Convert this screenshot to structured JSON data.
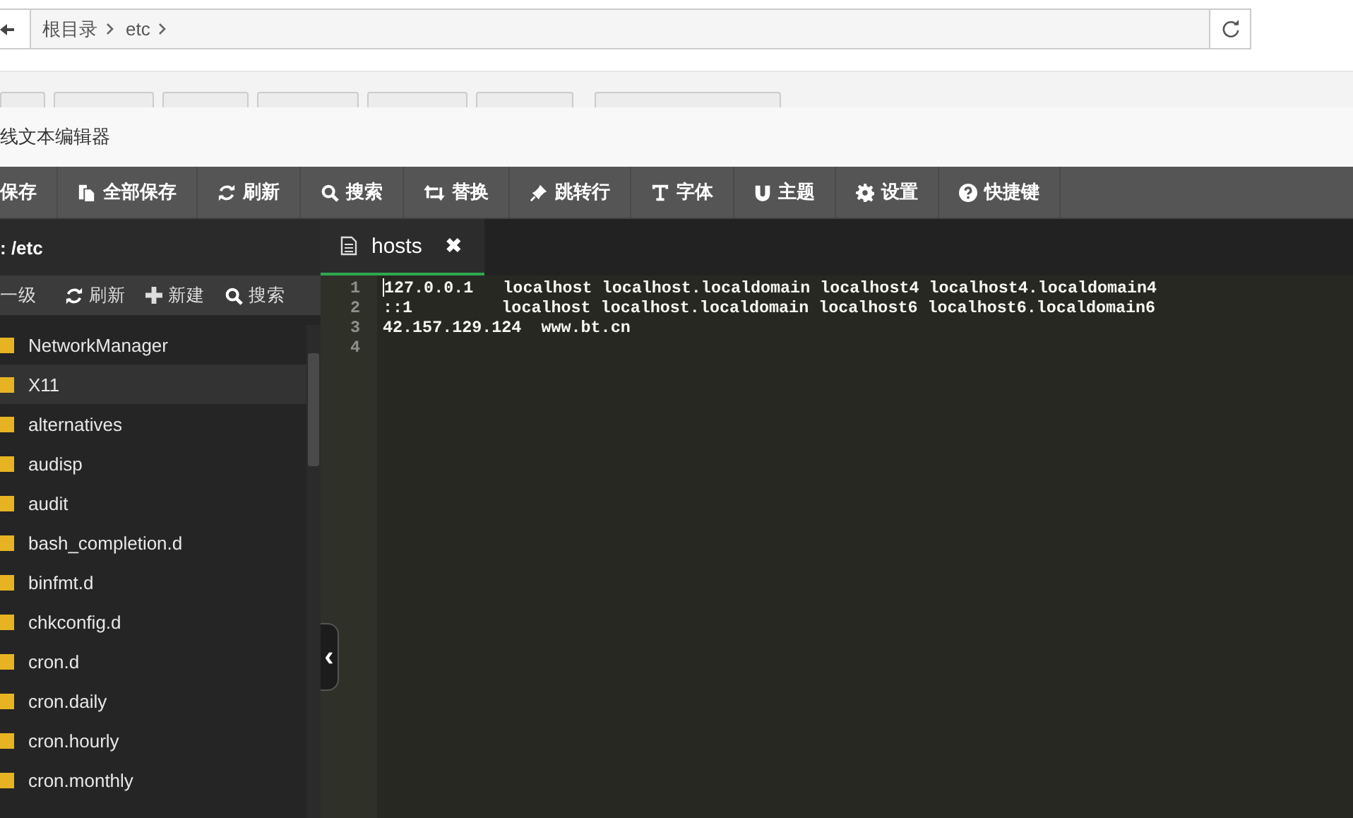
{
  "breadcrumb": {
    "items": [
      "根目录",
      "etc"
    ]
  },
  "editor_title": "线文本编辑器",
  "toolbar": [
    {
      "label": "保存"
    },
    {
      "label": "全部保存",
      "kind": "copy"
    },
    {
      "label": "刷新",
      "kind": "refresh"
    },
    {
      "label": "搜索",
      "kind": "search"
    },
    {
      "label": "替换",
      "kind": "swap"
    },
    {
      "label": "跳转行",
      "kind": "pin"
    },
    {
      "label": "字体",
      "kind": "font"
    },
    {
      "label": "主题",
      "kind": "magnet"
    },
    {
      "label": "设置",
      "kind": "gear"
    },
    {
      "label": "快捷键",
      "kind": "help"
    }
  ],
  "sidebar": {
    "path": ": /etc",
    "actions": [
      {
        "label": "一级"
      },
      {
        "label": "刷新",
        "kind": "refresh"
      },
      {
        "label": "新建",
        "kind": "plus"
      },
      {
        "label": "搜索",
        "kind": "search"
      }
    ],
    "items": [
      {
        "name": "NetworkManager",
        "selected": false
      },
      {
        "name": "X11",
        "selected": true
      },
      {
        "name": "alternatives",
        "selected": false
      },
      {
        "name": "audisp",
        "selected": false
      },
      {
        "name": "audit",
        "selected": false
      },
      {
        "name": "bash_completion.d",
        "selected": false
      },
      {
        "name": "binfmt.d",
        "selected": false
      },
      {
        "name": "chkconfig.d",
        "selected": false
      },
      {
        "name": "cron.d",
        "selected": false
      },
      {
        "name": "cron.daily",
        "selected": false
      },
      {
        "name": "cron.hourly",
        "selected": false
      },
      {
        "name": "cron.monthly",
        "selected": false
      }
    ]
  },
  "tabs": [
    {
      "label": "hosts",
      "selected": true,
      "close": "✖"
    }
  ],
  "collapse_handle": "‹",
  "code": [
    {
      "number": "1",
      "text": "127.0.0.1   localhost localhost.localdomain localhost4 localhost4.localdomain4"
    },
    {
      "number": "2",
      "text": "::1         localhost localhost.localdomain localhost6 localhost6.localdomain6"
    },
    {
      "number": "3",
      "text": "42.157.129.124  www.bt.cn"
    },
    {
      "number": "4"
    }
  ]
}
